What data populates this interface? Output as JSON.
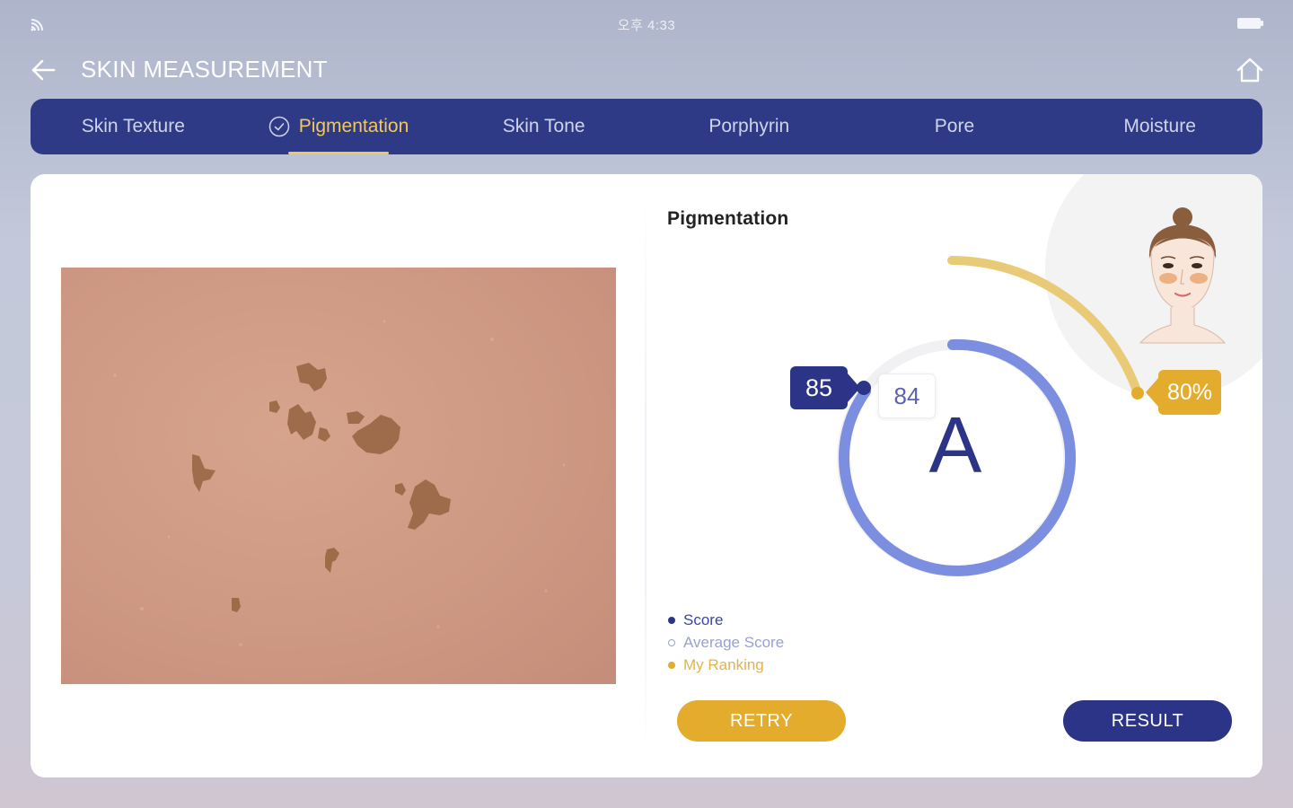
{
  "status_bar": {
    "time": "오후 4:33",
    "cast_icon": "cast-icon",
    "battery_icon": "battery-icon"
  },
  "header": {
    "title": "SKIN MEASUREMENT",
    "back_icon": "arrow-left-icon",
    "home_icon": "home-icon"
  },
  "tabs": [
    {
      "label": "Skin Texture",
      "active": false
    },
    {
      "label": "Pigmentation",
      "active": true,
      "icon": "check-circle-icon"
    },
    {
      "label": "Skin Tone",
      "active": false
    },
    {
      "label": "Porphyrin",
      "active": false
    },
    {
      "label": "Pore",
      "active": false
    },
    {
      "label": "Moisture",
      "active": false
    }
  ],
  "result": {
    "section_title": "Pigmentation",
    "score": "85",
    "average_score": "84",
    "grade": "A",
    "ranking": "80%",
    "ranking_fraction": 0.8
  },
  "legend": {
    "score": "Score",
    "average": "Average Score",
    "ranking": "My Ranking"
  },
  "buttons": {
    "retry": "RETRY",
    "result": "RESULT"
  },
  "colors": {
    "navy": "#2b3486",
    "gold": "#e3ac2c",
    "ring": "#7b8ee0"
  }
}
